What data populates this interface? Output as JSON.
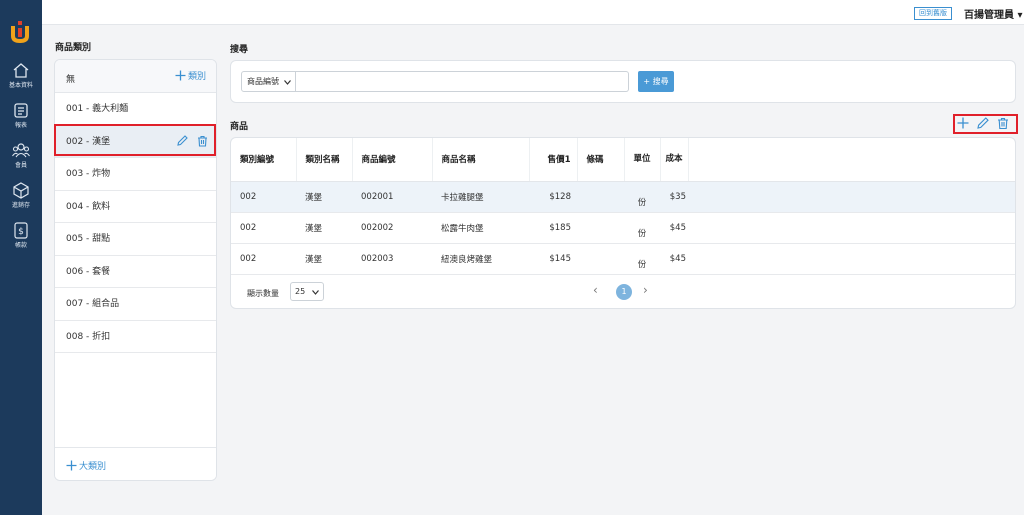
{
  "brand": {
    "accent": "#3a8fd0",
    "sidebar_bg": "#1c3a5c",
    "highlight": "#e0202a"
  },
  "sidebar": {
    "items": [
      {
        "icon": "home-icon",
        "label": "基本資料"
      },
      {
        "icon": "report-icon",
        "label": "報表"
      },
      {
        "icon": "members-icon",
        "label": "會員"
      },
      {
        "icon": "inventory-box-icon",
        "label": "進銷存"
      },
      {
        "icon": "dollar-icon",
        "label": "帳款"
      }
    ]
  },
  "topbar": {
    "old_version": "回到舊版",
    "user": "百揚管理員 ▾"
  },
  "categories": {
    "title": "商品類別",
    "none_label": "無",
    "add_label": "類別",
    "items": [
      "001 - 義大利麵",
      "002 - 漢堡",
      "003 - 炸物",
      "004 - 飲料",
      "005 - 甜點",
      "006 - 套餐",
      "007 - 組合品",
      "008 - 折扣"
    ],
    "selected_index": 1,
    "add_big_label": "大類別"
  },
  "search": {
    "title": "搜尋",
    "field_select": "商品編號",
    "input_value": "",
    "button": "+ 搜尋"
  },
  "products": {
    "title": "商品",
    "columns": [
      "類別編號",
      "類別名稱",
      "商品編號",
      "商品名稱",
      "售價1",
      "條碼",
      "單位",
      "成本"
    ],
    "rows": [
      {
        "cat_no": "002",
        "cat_name": "漢堡",
        "prod_no": "002001",
        "prod_name": "卡拉雞腿堡",
        "price": "$128",
        "barcode": "",
        "unit": "份",
        "cost": "$35"
      },
      {
        "cat_no": "002",
        "cat_name": "漢堡",
        "prod_no": "002002",
        "prod_name": "松露牛肉堡",
        "price": "$185",
        "barcode": "",
        "unit": "份",
        "cost": "$45"
      },
      {
        "cat_no": "002",
        "cat_name": "漢堡",
        "prod_no": "002003",
        "prod_name": "紐澳良烤雞堡",
        "price": "$145",
        "barcode": "",
        "unit": "份",
        "cost": "$45"
      }
    ],
    "page_size_label": "顯示數量",
    "page_size": "25",
    "current_page": "1"
  }
}
